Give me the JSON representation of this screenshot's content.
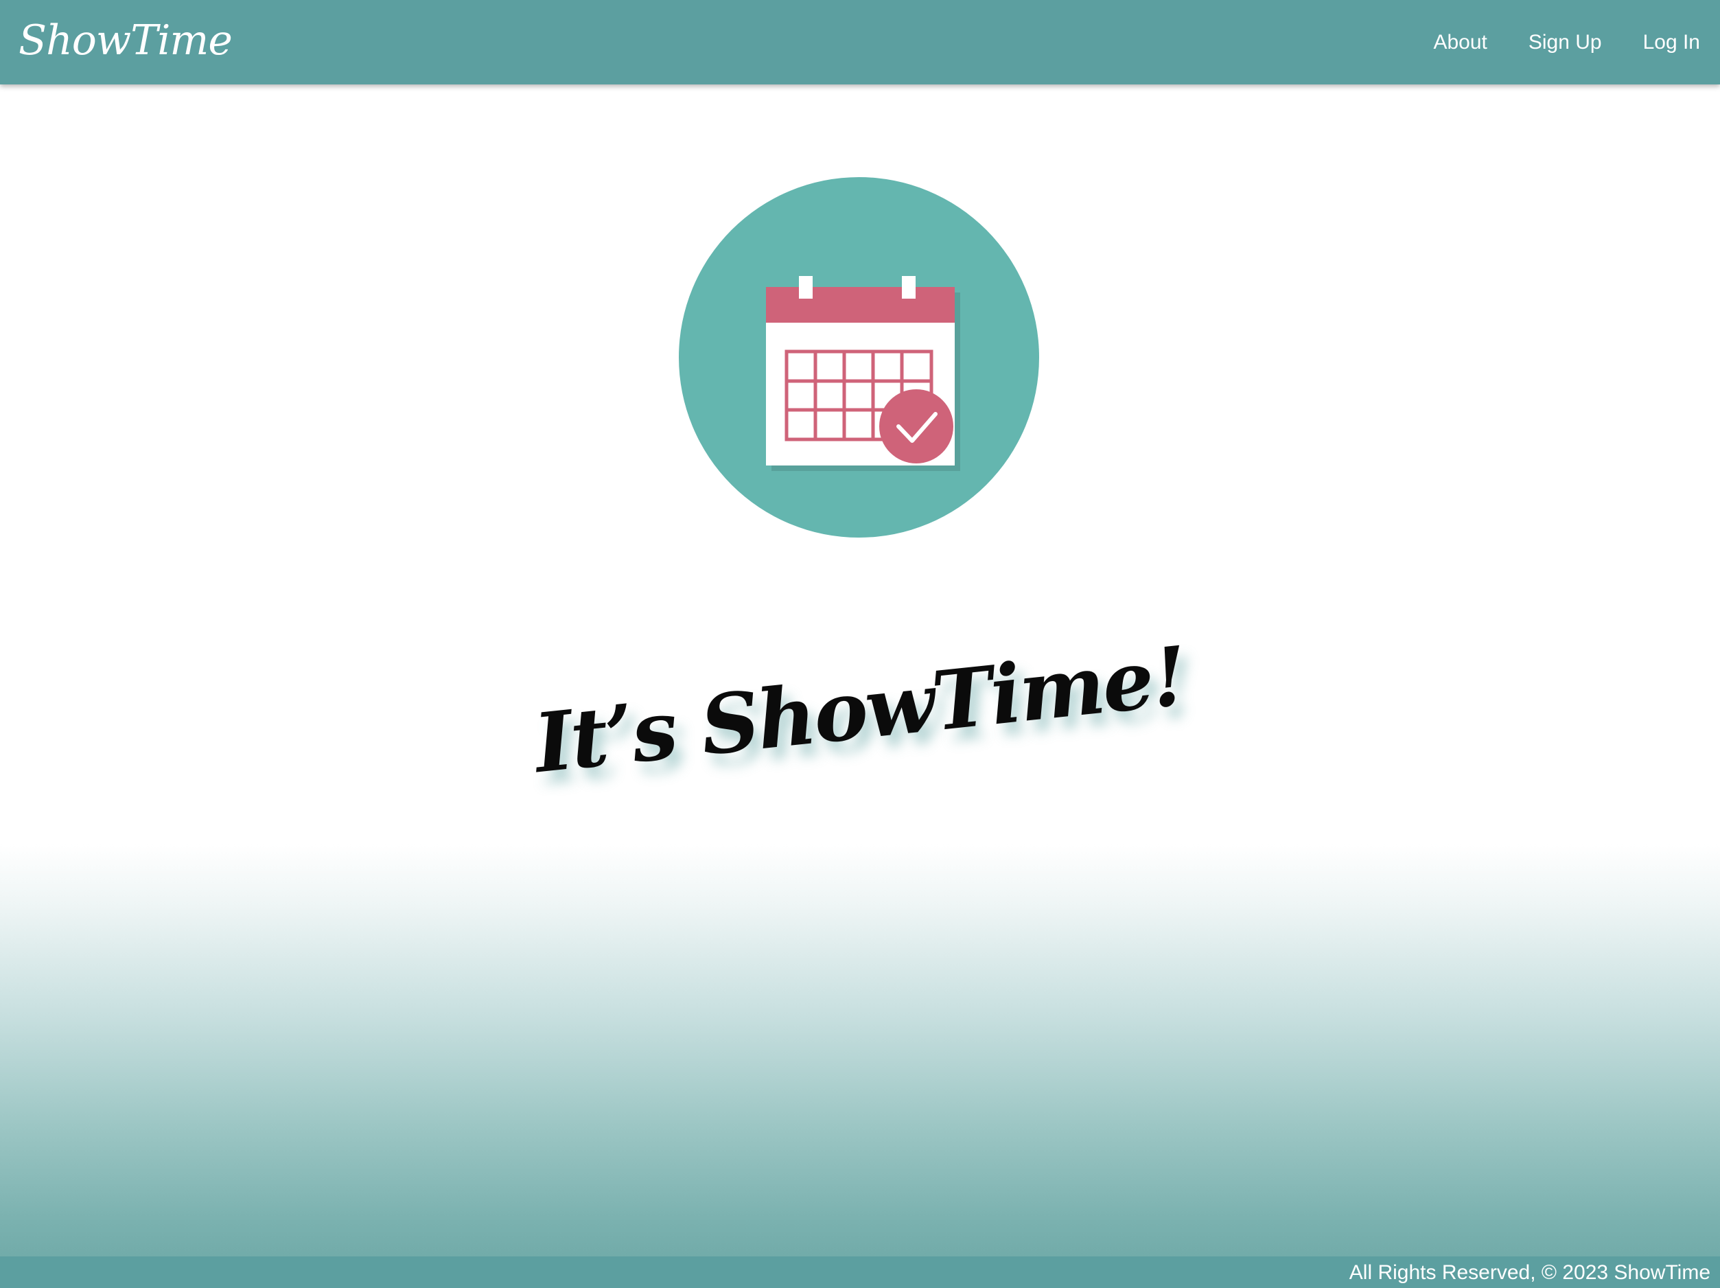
{
  "navbar": {
    "brand": "ShowTime",
    "links": [
      {
        "label": "About"
      },
      {
        "label": "Sign Up"
      },
      {
        "label": "Log In"
      }
    ]
  },
  "hero": {
    "icon": "calendar-check-icon",
    "title": "It’s ShowTime!"
  },
  "footer": {
    "text": "All Rights Reserved, © 2023 ShowTime"
  },
  "colors": {
    "teal_primary": "#5c9fa0",
    "teal_circle": "#64b6af",
    "calendar_pink": "#cf6379",
    "white": "#ffffff"
  }
}
